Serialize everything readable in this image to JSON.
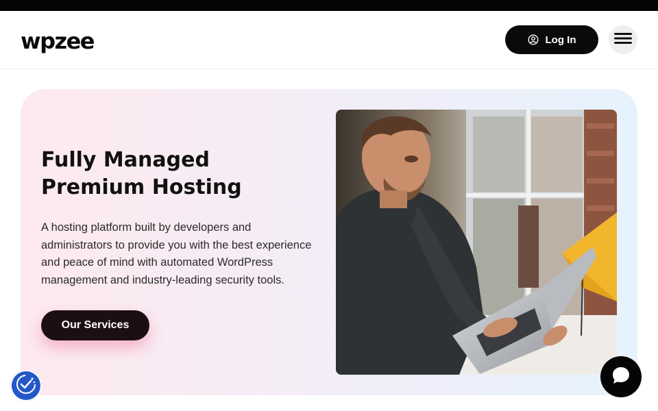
{
  "header": {
    "logo_text": "wpzee",
    "login_label": "Log In",
    "icons": {
      "login": "user-circle-icon",
      "menu": "hamburger-menu-icon"
    }
  },
  "hero": {
    "title_line1": "Fully Managed",
    "title_line2": "Premium Hosting",
    "description": "A hosting platform built by developers and administrators to provide you with the best experience and peace of mind with automated WordPress management and industry-leading security tools.",
    "cta_label": "Our Services",
    "image": "man-working-on-laptop-photo"
  },
  "widgets": {
    "accessibility_icon": "accessibility-icon",
    "chat_icon": "chat-bubble-icon"
  },
  "colors": {
    "topbar": "#050505",
    "button_dark": "#0a0a0a",
    "cta": "#1c0f14",
    "cta_glow": "#ee6996",
    "accessibility": "#2458c6"
  }
}
